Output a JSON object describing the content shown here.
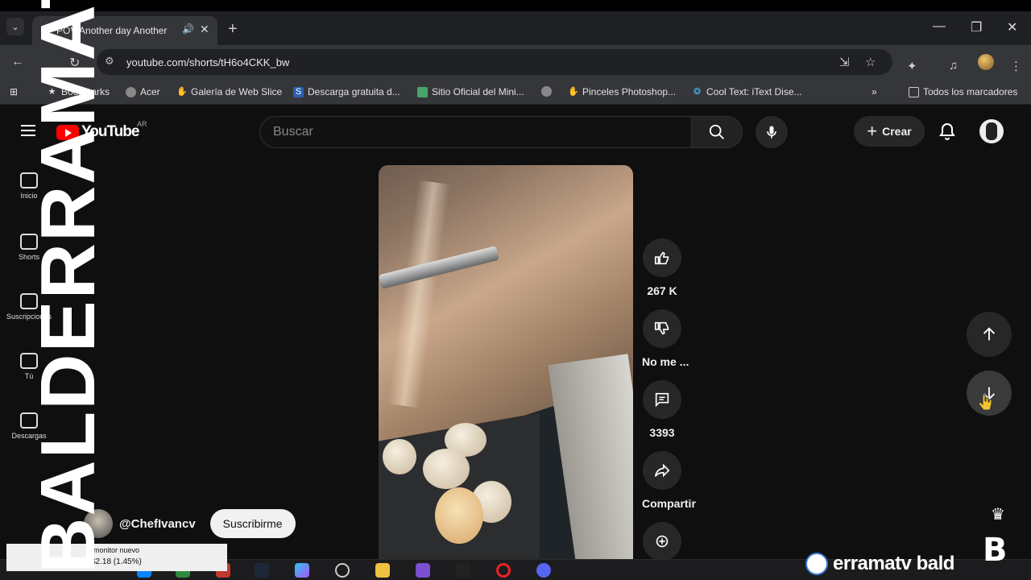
{
  "browser": {
    "tab_title": "POV Another day Another N",
    "url": "youtube.com/shorts/tH6o4CKK_bw",
    "bookmarks": [
      {
        "label": "Bookmarks"
      },
      {
        "label": "Acer"
      },
      {
        "label": "Galería de Web Slice"
      },
      {
        "label": "Descarga gratuita d..."
      },
      {
        "label": "Sitio Oficial del Mini..."
      },
      {
        "label": "Pinceles Photoshop..."
      },
      {
        "label": "Cool Text: iText Dise..."
      }
    ],
    "all_bookmarks_label": "Todos los marcadores"
  },
  "youtube": {
    "logo_text": "YouTube",
    "country_code": "AR",
    "search_placeholder": "Buscar",
    "create_label": "Crear",
    "guide": [
      {
        "label": "Inicio"
      },
      {
        "label": "Shorts"
      },
      {
        "label": "Suscripciones"
      },
      {
        "label": "Tú"
      },
      {
        "label": "Descargas"
      }
    ]
  },
  "short": {
    "likes": "267 K",
    "dislike_label": "No me ...",
    "comments": "3393",
    "share_label": "Compartir",
    "channel_name": "@ChefIvancv",
    "subscribe_label": "Suscribirme"
  },
  "overlay": {
    "watermark_text": "BALDERRAMAT",
    "brand_text": "erramatv bald",
    "stock_title": "monitor nuevo",
    "stock_value": "$2.18 (1.45%)",
    "accent_color": "#ff0000"
  }
}
